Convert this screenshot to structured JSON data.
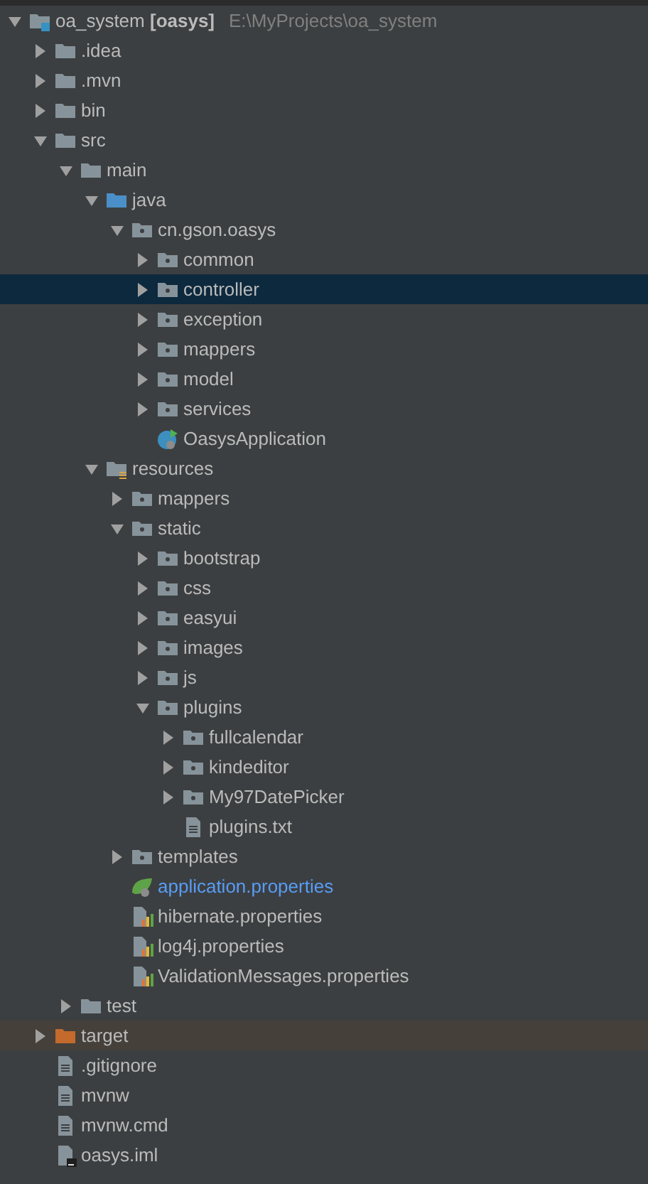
{
  "tree": [
    {
      "label": "oa_system **[oasys]**",
      "path": "E:\\MyProjects\\oa_system",
      "kind": "module",
      "expanded": true,
      "selected": false,
      "children": [
        {
          "label": ".idea",
          "kind": "folder",
          "expanded": false,
          "selected": false
        },
        {
          "label": ".mvn",
          "kind": "folder",
          "expanded": false,
          "selected": false
        },
        {
          "label": "bin",
          "kind": "folder",
          "expanded": false,
          "selected": false
        },
        {
          "label": "src",
          "kind": "folder",
          "expanded": true,
          "selected": false,
          "children": [
            {
              "label": "main",
              "kind": "folder",
              "expanded": true,
              "selected": false,
              "children": [
                {
                  "label": "java",
                  "kind": "source",
                  "expanded": true,
                  "selected": false,
                  "children": [
                    {
                      "label": "cn.gson.oasys",
                      "kind": "package",
                      "expanded": true,
                      "selected": false,
                      "children": [
                        {
                          "label": "common",
                          "kind": "package",
                          "expanded": false,
                          "selected": false
                        },
                        {
                          "label": "controller",
                          "kind": "package",
                          "expanded": false,
                          "selected": true
                        },
                        {
                          "label": "exception",
                          "kind": "package",
                          "expanded": false,
                          "selected": false
                        },
                        {
                          "label": "mappers",
                          "kind": "package",
                          "expanded": false,
                          "selected": false
                        },
                        {
                          "label": "model",
                          "kind": "package",
                          "expanded": false,
                          "selected": false
                        },
                        {
                          "label": "services",
                          "kind": "package",
                          "expanded": false,
                          "selected": false
                        },
                        {
                          "label": "OasysApplication",
                          "kind": "app-class",
                          "selected": false
                        }
                      ]
                    }
                  ]
                },
                {
                  "label": "resources",
                  "kind": "resources",
                  "expanded": true,
                  "selected": false,
                  "children": [
                    {
                      "label": "mappers",
                      "kind": "package",
                      "expanded": false,
                      "selected": false
                    },
                    {
                      "label": "static",
                      "kind": "package",
                      "expanded": true,
                      "selected": false,
                      "children": [
                        {
                          "label": "bootstrap",
                          "kind": "package",
                          "expanded": false,
                          "selected": false
                        },
                        {
                          "label": "css",
                          "kind": "package",
                          "expanded": false,
                          "selected": false
                        },
                        {
                          "label": "easyui",
                          "kind": "package",
                          "expanded": false,
                          "selected": false
                        },
                        {
                          "label": "images",
                          "kind": "package",
                          "expanded": false,
                          "selected": false
                        },
                        {
                          "label": "js",
                          "kind": "package",
                          "expanded": false,
                          "selected": false
                        },
                        {
                          "label": "plugins",
                          "kind": "package",
                          "expanded": true,
                          "selected": false,
                          "children": [
                            {
                              "label": "fullcalendar",
                              "kind": "package",
                              "expanded": false,
                              "selected": false
                            },
                            {
                              "label": "kindeditor",
                              "kind": "package",
                              "expanded": false,
                              "selected": false
                            },
                            {
                              "label": "My97DatePicker",
                              "kind": "package",
                              "expanded": false,
                              "selected": false
                            },
                            {
                              "label": "plugins.txt",
                              "kind": "text",
                              "selected": false
                            }
                          ]
                        }
                      ]
                    },
                    {
                      "label": "templates",
                      "kind": "package",
                      "expanded": false,
                      "selected": false
                    },
                    {
                      "label": "application.properties",
                      "kind": "spring",
                      "selected": false
                    },
                    {
                      "label": "hibernate.properties",
                      "kind": "props",
                      "selected": false
                    },
                    {
                      "label": "log4j.properties",
                      "kind": "props",
                      "selected": false
                    },
                    {
                      "label": "ValidationMessages.properties",
                      "kind": "props",
                      "selected": false
                    }
                  ]
                }
              ]
            },
            {
              "label": "test",
              "kind": "folder",
              "expanded": false,
              "selected": false
            }
          ]
        },
        {
          "label": "target",
          "kind": "excluded",
          "expanded": false,
          "selected": false
        },
        {
          "label": ".gitignore",
          "kind": "text",
          "selected": false
        },
        {
          "label": "mvnw",
          "kind": "text",
          "selected": false
        },
        {
          "label": "mvnw.cmd",
          "kind": "text",
          "selected": false
        },
        {
          "label": "oasys.iml",
          "kind": "iml",
          "selected": false
        }
      ]
    }
  ]
}
